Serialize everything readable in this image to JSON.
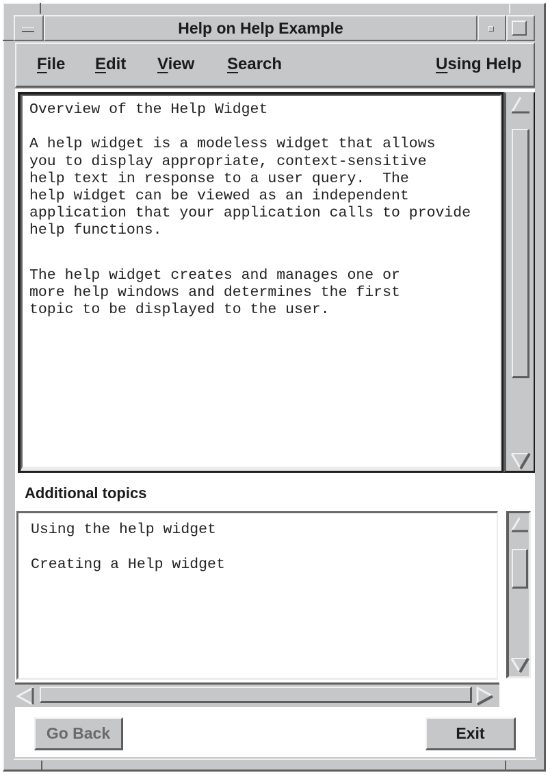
{
  "window": {
    "title": "Help on Help Example",
    "window_menu_icon": "window-menu-icon",
    "minimize_icon": "minimize-icon",
    "maximize_icon": "maximize-icon"
  },
  "menubar": {
    "items": [
      {
        "mnemonic": "F",
        "rest": "ile",
        "label": "File"
      },
      {
        "mnemonic": "E",
        "rest": "dit",
        "label": "Edit"
      },
      {
        "mnemonic": "V",
        "rest": "iew",
        "label": "View"
      },
      {
        "mnemonic": "S",
        "rest": "earch",
        "label": "Search"
      }
    ],
    "help": {
      "mnemonic": "U",
      "rest": "sing Help",
      "label": "Using Help"
    }
  },
  "help_text": {
    "lines": [
      "Overview of the Help Widget",
      "",
      "A help widget is a modeless widget that allows",
      "you to display appropriate, context-sensitive",
      "help text in response to a user query.  The",
      "help widget can be viewed as an independent",
      "application that your application calls to provide",
      "help functions.",
      "",
      "",
      "The help widget creates and manages one or",
      "more help windows and determines the first",
      "topic to be displayed to the user."
    ]
  },
  "additional_topics": {
    "label": "Additional topics",
    "items": [
      "Using the help widget",
      "Creating a Help widget"
    ]
  },
  "buttons": {
    "go_back": "Go Back",
    "exit": "Exit"
  },
  "colors": {
    "chrome": "#c6c7c9",
    "shadow": "#5e5e5e",
    "highlight": "#f0f0f0",
    "text": "#1b1b1b",
    "disabled_text": "#6a6a6a"
  }
}
